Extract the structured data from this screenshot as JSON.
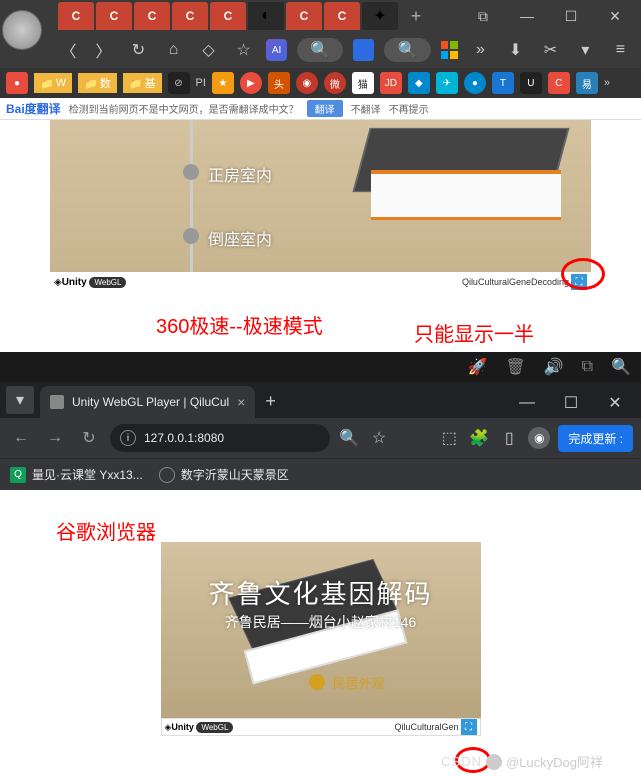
{
  "browser360": {
    "tabs": [
      "C",
      "C",
      "C",
      "C",
      "C",
      "",
      "C",
      "C",
      ""
    ],
    "bookmarks": {
      "folder_w": "W",
      "folder_shu": "数",
      "folder_ji": "基",
      "pi_label": "PI"
    },
    "translate_bar": {
      "logo": "Bai度翻译",
      "detect": "检测到当前网页不是中文网页，是否需翻译成中文？",
      "translate_btn": "翻译",
      "no_translate": "不翻译",
      "never": "不再提示"
    }
  },
  "unity1": {
    "label1": "正房室内",
    "label2": "倒座室内",
    "unity": "Unity",
    "webgl": "WebGL",
    "project": "QiluCulturalGeneDecoding"
  },
  "annotations": {
    "a1": "360极速--极速模式",
    "a2": "只能显示一半",
    "a3": "谷歌浏览器"
  },
  "chrome": {
    "tab_title": "Unity WebGL Player | QiluCul",
    "url": "127.0.0.1:8080",
    "update_btn": "完成更新 :",
    "bookmark1": "量见·云课堂 Yxx13...",
    "bookmark2": "数字沂蒙山天蒙景区"
  },
  "unity2": {
    "title": "齐鲁文化基因解码",
    "subtitle": "齐鲁民居——烟台小赵家村146",
    "spot": "民居外观",
    "unity": "Unity",
    "webgl": "WebGL",
    "project": "QiluCulturalGen"
  },
  "watermark": {
    "csdn": "CSDN",
    "user": "@LuckyDog阿祥"
  }
}
